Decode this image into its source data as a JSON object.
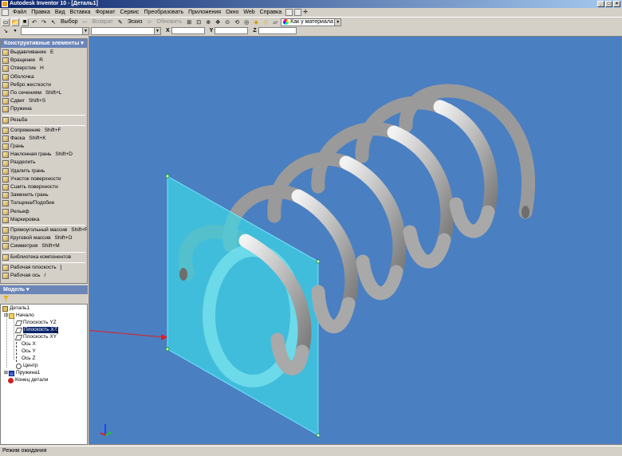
{
  "window": {
    "title": "Autodesk Inventor 10 - [Деталь1]"
  },
  "menu": [
    "Файл",
    "Правка",
    "Вид",
    "Вставка",
    "Формат",
    "Сервис",
    "Преобразовать",
    "Приложения",
    "Окно",
    "Web",
    "Справка"
  ],
  "toolbar": {
    "select_label": "Выбор",
    "return_label": "Возврат",
    "sketch_label": "Эскиз",
    "update_label": "Обновить",
    "material_combo": "Как у материала"
  },
  "coords": {
    "x_label": "X",
    "y_label": "Y",
    "z_label": "Z"
  },
  "features_panel": {
    "title": "Конструктивные элементы ▾",
    "items": [
      {
        "label": "Выдавливание",
        "shortcut": "E"
      },
      {
        "label": "Вращение",
        "shortcut": "R"
      },
      {
        "label": "Отверстие",
        "shortcut": "H"
      },
      {
        "label": "Оболочка",
        "shortcut": ""
      },
      {
        "label": "Ребро жесткости",
        "shortcut": ""
      },
      {
        "label": "По сечениям",
        "shortcut": "Shift+L"
      },
      {
        "label": "Сдвиг",
        "shortcut": "Shift+S"
      },
      {
        "label": "Пружина",
        "shortcut": ""
      },
      {
        "label": "Резьба",
        "shortcut": ""
      },
      {
        "label": "Сопряжение",
        "shortcut": "Shift+F"
      },
      {
        "label": "Фаска",
        "shortcut": "Shift+K"
      },
      {
        "label": "Грань",
        "shortcut": ""
      },
      {
        "label": "Наклонная грань",
        "shortcut": "Shift+D"
      },
      {
        "label": "Разделить",
        "shortcut": ""
      },
      {
        "label": "Удалить грань",
        "shortcut": ""
      },
      {
        "label": "Участок поверхности",
        "shortcut": ""
      },
      {
        "label": "Сшить поверхности",
        "shortcut": ""
      },
      {
        "label": "Заменить грань",
        "shortcut": ""
      },
      {
        "label": "Толщина/Подобие",
        "shortcut": ""
      },
      {
        "label": "Рельеф",
        "shortcut": ""
      },
      {
        "label": "Маркировка",
        "shortcut": ""
      },
      {
        "label": "Прямоугольный массив",
        "shortcut": "Shift+R"
      },
      {
        "label": "Круговой массив",
        "shortcut": "Shift+O"
      },
      {
        "label": "Симметрия",
        "shortcut": "Shift+M"
      },
      {
        "label": "Библиотека компонентов",
        "shortcut": ""
      },
      {
        "label": "Рабочая плоскость",
        "shortcut": "]"
      },
      {
        "label": "Рабочая ось",
        "shortcut": "/"
      }
    ]
  },
  "model_panel": {
    "title": "Модель ▾",
    "tree": {
      "root": "Деталь1",
      "origin": "Начало",
      "plane_yz": "Плоскость YZ",
      "plane_xz": "Плоскость XZ",
      "plane_xy": "Плоскость XY",
      "axis_x": "Ось X",
      "axis_y": "Ось Y",
      "axis_z": "Ось Z",
      "center": "Центр",
      "spring": "Пружина1",
      "end": "Конец детали"
    }
  },
  "status": {
    "text": "Режим ожидания"
  },
  "colors": {
    "viewport_bg": "#4a7fc2",
    "plane_fill": "#3fd6e6",
    "spring_metal": "#c8c8c8",
    "selection": "#0a246a"
  }
}
